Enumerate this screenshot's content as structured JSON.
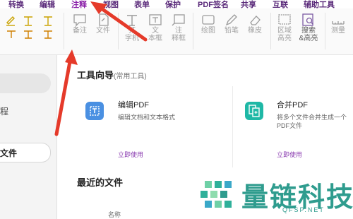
{
  "menubar": {
    "items": [
      {
        "label": "转换"
      },
      {
        "label": "编辑"
      },
      {
        "label": "注释"
      },
      {
        "label": "视图"
      },
      {
        "label": "表单"
      },
      {
        "label": "保护"
      },
      {
        "label": "PDF签名"
      },
      {
        "label": "共享"
      },
      {
        "label": "互联"
      },
      {
        "label": "辅助工具"
      }
    ],
    "active": "注释"
  },
  "toolbar": {
    "tools": [
      {
        "label": "备注",
        "icon": "note-icon"
      },
      {
        "label": "文件",
        "icon": "file-attach-icon"
      },
      {
        "label": "打\n字机",
        "icon": "typewriter-icon"
      },
      {
        "label": "文\n本框",
        "icon": "textbox-icon"
      },
      {
        "label": "注\n释框",
        "icon": "callout-icon"
      },
      {
        "label": "绘图",
        "icon": "drawing-icon"
      },
      {
        "label": "铅笔",
        "icon": "pencil-icon"
      },
      {
        "label": "橡皮",
        "icon": "eraser-icon"
      },
      {
        "label": "区域\n高亮",
        "icon": "area-highlight-icon"
      },
      {
        "label": "搜索\n&高亮",
        "icon": "search-highlight-icon"
      },
      {
        "label": "测量",
        "icon": "measure-icon"
      }
    ]
  },
  "left_panel": {
    "text_item": "程",
    "selected_item": "文件"
  },
  "content": {
    "tool_guide_title": "工具向导",
    "tool_guide_sub": "(常用工具)",
    "cards": [
      {
        "title": "编辑PDF",
        "desc": "编辑文档和文本格式",
        "link": "立即使用",
        "color": "#4a90e2"
      },
      {
        "title": "合并PDF",
        "desc": "将多个文件合并生成一个PDF文件",
        "link": "立即使用",
        "color": "#1fb8a6"
      }
    ],
    "recent_title": "最近的文件",
    "col_name": "名称"
  },
  "watermark": {
    "text": "量链科技",
    "sub": "QFSP.NET"
  }
}
